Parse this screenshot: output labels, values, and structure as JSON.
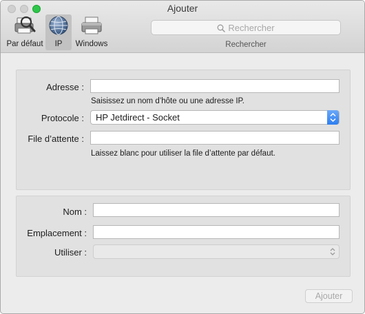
{
  "window": {
    "title": "Ajouter"
  },
  "toolbar": {
    "default_label": "Par défaut",
    "ip_label": "IP",
    "windows_label": "Windows"
  },
  "search": {
    "placeholder": "Rechercher",
    "caption": "Rechercher"
  },
  "form": {
    "address_label": "Adresse :",
    "address_value": "",
    "address_hint": "Saisissez un nom d’hôte ou une adresse IP.",
    "protocol_label": "Protocole :",
    "protocol_value": "HP Jetdirect - Socket",
    "queue_label": "File d’attente :",
    "queue_value": "",
    "queue_hint": "Laissez blanc pour utiliser la file d’attente par défaut.",
    "name_label": "Nom :",
    "name_value": "",
    "location_label": "Emplacement :",
    "location_value": "",
    "use_label": "Utiliser :",
    "use_value": ""
  },
  "footer": {
    "add_label": "Ajouter"
  },
  "colors": {
    "accent": "#2e7ef0",
    "selected_tab": "#c2c2c2",
    "zoom_button": "#2ec64a"
  }
}
